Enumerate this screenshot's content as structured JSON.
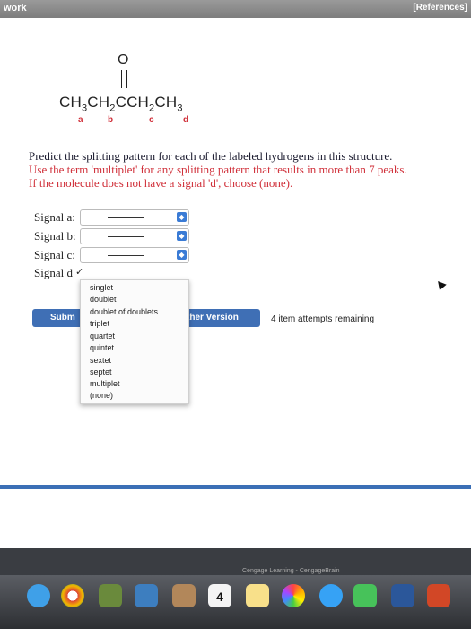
{
  "topbar": {
    "left": "work",
    "right": "[References]"
  },
  "molecule": {
    "oxygen": "O",
    "formula_parts": [
      "CH",
      "3",
      "CH",
      "2",
      "CCH",
      "2",
      "CH",
      "3"
    ],
    "labels": [
      "a",
      "b",
      "c",
      "d"
    ]
  },
  "instructions": {
    "line1": "Predict the splitting pattern for each of the labeled hydrogens in this structure.",
    "line2": "Use the term 'multiplet' for any splitting pattern that results in more than 7 peaks.",
    "line3": "If the molecule does not have a signal 'd', choose (none)."
  },
  "signals": [
    {
      "label": "Signal a:"
    },
    {
      "label": "Signal b:"
    },
    {
      "label": "Signal c:"
    },
    {
      "label": "Signal d"
    }
  ],
  "dropdown": {
    "check": "✓",
    "options": [
      "singlet",
      "doublet",
      "doublet of doublets",
      "triplet",
      "quartet",
      "quintet",
      "sextet",
      "septet",
      "multiplet",
      "(none)"
    ]
  },
  "buttons": {
    "submit": "Subm",
    "another": "ther Version"
  },
  "attempts": "4 item attempts remaining",
  "dock": {
    "calendar_day": "4",
    "title": "Cengage Learning - CengageBrain"
  },
  "colors": {
    "accent": "#3f6fb5",
    "warning_text": "#d0303a"
  }
}
